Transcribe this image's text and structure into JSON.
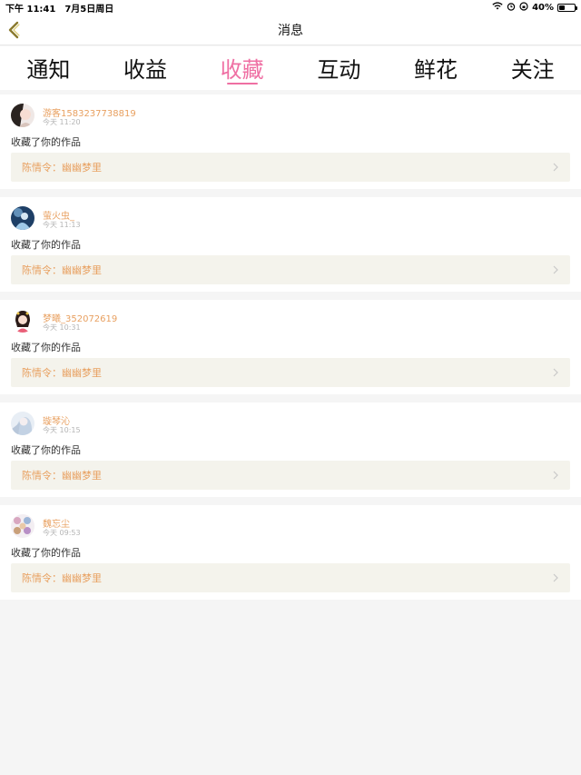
{
  "status": {
    "time": "下午 11:41",
    "date": "7月5日周日",
    "battery": "40%",
    "battery_level": 0.4
  },
  "nav": {
    "title": "消息"
  },
  "tabs": [
    {
      "label": "通知"
    },
    {
      "label": "收益"
    },
    {
      "label": "收藏",
      "active": true
    },
    {
      "label": "互动"
    },
    {
      "label": "鲜花"
    },
    {
      "label": "关注"
    }
  ],
  "items": [
    {
      "user": "游客1583237738819",
      "time": "今天 11:20",
      "action": "收藏了你的作品",
      "work": "陈情令：幽幽梦里",
      "avatar_icon": "avatar-anime-girl-icon"
    },
    {
      "user": "萤火虫_",
      "time": "今天 11:13",
      "action": "收藏了你的作品",
      "work": "陈情令：幽幽梦里",
      "avatar_icon": "avatar-blue-figure-icon"
    },
    {
      "user": "梦曦_352072619",
      "time": "今天 10:31",
      "action": "收藏了你的作品",
      "work": "陈情令：幽幽梦里",
      "avatar_icon": "avatar-costume-girl-icon"
    },
    {
      "user": "璇琴沁",
      "time": "今天 10:15",
      "action": "收藏了你的作品",
      "work": "陈情令：幽幽梦里",
      "avatar_icon": "avatar-pale-figure-icon"
    },
    {
      "user": "魏忘尘",
      "time": "今天 09:53",
      "action": "收藏了你的作品",
      "work": "陈情令：幽幽梦里",
      "avatar_icon": "avatar-group-icon"
    }
  ],
  "colors": {
    "accent": "#ef6fa3",
    "username": "#e8a060",
    "work_bg": "#f4f3ec",
    "back_arrow": "#8a7a2e"
  }
}
